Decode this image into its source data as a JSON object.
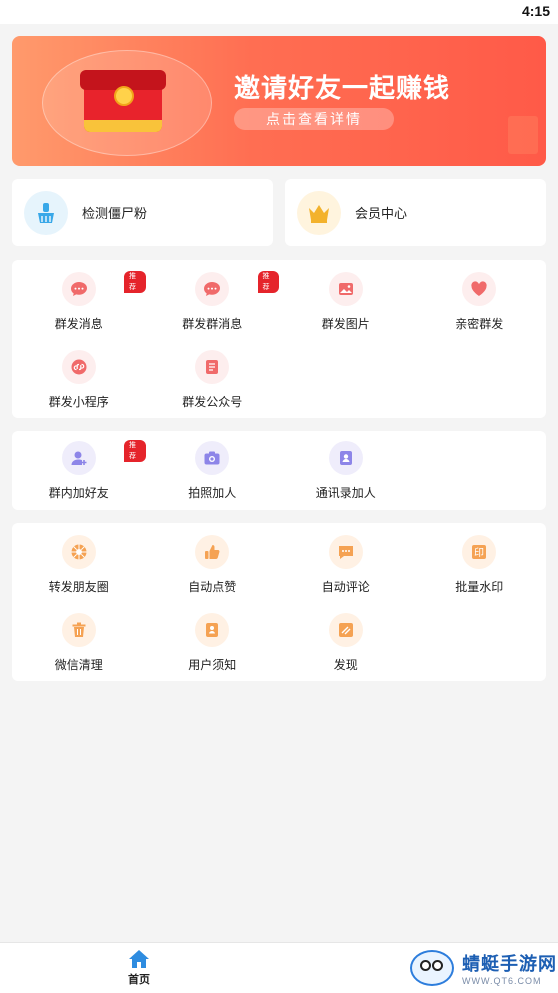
{
  "status": {
    "time": "4:15"
  },
  "banner": {
    "title": "邀请好友一起赚钱",
    "button": "点击查看详情"
  },
  "quick": [
    {
      "label": "检测僵尸粉",
      "icon": "broom-icon"
    },
    {
      "label": "会员中心",
      "icon": "crown-icon"
    }
  ],
  "badge": "推荐",
  "section1": [
    {
      "label": "群发消息",
      "icon": "chat-bubble-icon",
      "badge": true
    },
    {
      "label": "群发群消息",
      "icon": "group-chat-icon",
      "badge": true
    },
    {
      "label": "群发图片",
      "icon": "image-icon",
      "badge": false
    },
    {
      "label": "亲密群发",
      "icon": "heart-icon",
      "badge": false
    },
    {
      "label": "群发小程序",
      "icon": "mini-program-icon",
      "badge": false
    },
    {
      "label": "群发公众号",
      "icon": "official-account-icon",
      "badge": false
    }
  ],
  "section2": [
    {
      "label": "群内加好友",
      "icon": "add-user-icon",
      "badge": true
    },
    {
      "label": "拍照加人",
      "icon": "camera-icon",
      "badge": false
    },
    {
      "label": "通讯录加人",
      "icon": "contacts-icon",
      "badge": false
    }
  ],
  "section3": [
    {
      "label": "转发朋友圈",
      "icon": "moments-icon"
    },
    {
      "label": "自动点赞",
      "icon": "thumbs-up-icon"
    },
    {
      "label": "自动评论",
      "icon": "comment-icon"
    },
    {
      "label": "批量水印",
      "icon": "stamp-icon"
    },
    {
      "label": "微信清理",
      "icon": "trash-icon"
    },
    {
      "label": "用户须知",
      "icon": "notice-icon"
    },
    {
      "label": "发现",
      "icon": "discover-icon"
    }
  ],
  "tabbar": {
    "home": "首页"
  },
  "watermark": {
    "name": "蜻蜓手游网",
    "url": "WWW.QT6.COM"
  },
  "colors": {
    "accent": "#ff6e52",
    "badge": "#e5242b",
    "pink_bg": "#fdeeee",
    "purple_bg": "#efedfb",
    "orange_bg": "#fff1e4",
    "pink_fg": "#f06a6a",
    "purple_fg": "#8d85e8",
    "orange_fg": "#f5a253"
  }
}
